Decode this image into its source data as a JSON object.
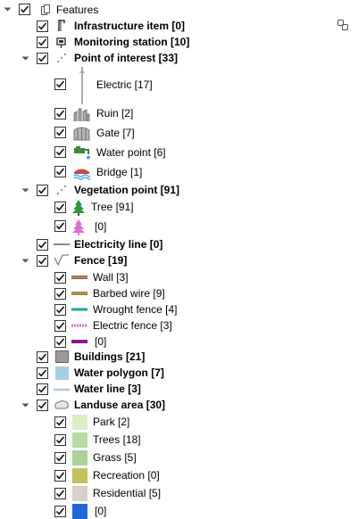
{
  "root": {
    "label": "Features"
  },
  "rows": [
    {
      "label": "Infrastructure item [0]",
      "bold": true
    },
    {
      "label": "Monitoring station [10]",
      "bold": true
    },
    {
      "label": "Point of interest [33]",
      "bold": true
    },
    {
      "label": "Electric [17]",
      "bold": false
    },
    {
      "label": "Ruin [2]",
      "bold": false
    },
    {
      "label": "Gate [7]",
      "bold": false
    },
    {
      "label": "Water point [6]",
      "bold": false
    },
    {
      "label": "Bridge [1]",
      "bold": false
    },
    {
      "label": "Vegetation point [91]",
      "bold": true
    },
    {
      "label": "Tree [91]",
      "bold": false
    },
    {
      "label": "[0]",
      "bold": false
    },
    {
      "label": "Electricity line [0]",
      "bold": true
    },
    {
      "label": "Fence [19]",
      "bold": true
    },
    {
      "label": "Wall [3]",
      "bold": false
    },
    {
      "label": "Barbed wire [9]",
      "bold": false
    },
    {
      "label": "Wrought fence [4]",
      "bold": false
    },
    {
      "label": "Electric fence [3]",
      "bold": false
    },
    {
      "label": "[0]",
      "bold": false
    },
    {
      "label": "Buildings [21]",
      "bold": true
    },
    {
      "label": "Water polygon [7]",
      "bold": true
    },
    {
      "label": "Water line [3]",
      "bold": true
    },
    {
      "label": "Landuse area [30]",
      "bold": true
    },
    {
      "label": "Park [2]",
      "bold": false
    },
    {
      "label": "Trees [18]",
      "bold": false
    },
    {
      "label": "Grass [5]",
      "bold": false
    },
    {
      "label": "Recreation [0]",
      "bold": false
    },
    {
      "label": "Residential [5]",
      "bold": false
    },
    {
      "label": "[0]",
      "bold": false
    }
  ],
  "colors": {
    "wall": "#8b5a3c",
    "barbed_wire": "#9a7b3a",
    "wrought_fence": "#16a99a",
    "electric_fence": "#d86fd1",
    "fence_unknown": "#8a1a8a",
    "buildings": "#9a9a9a",
    "water_polygon": "#a6cee3",
    "water_line": "#a6cee3",
    "electricity_line": "#8a8a8a",
    "park": "#d9efc2",
    "trees": "#b7dca3",
    "grass": "#a9d19a",
    "recreation": "#c1c35e",
    "residential": "#d8cfca",
    "landuse_unknown": "#2266d6",
    "tree_icon": "#2c9a3c",
    "tree_unknown_icon": "#d86fd1"
  },
  "icons": {
    "root": "features-group-icon",
    "infrastructure": "infrastructure-item-icon",
    "monitoring": "monitoring-station-icon",
    "poi": "point-of-interest-icon",
    "electric": "electric-pole-icon",
    "ruin": "ruin-icon",
    "gate": "gate-icon",
    "water_point": "water-point-icon",
    "bridge": "bridge-icon",
    "vegetation": "vegetation-point-icon",
    "tree": "tree-icon",
    "fence": "fence-group-icon",
    "landuse": "landuse-group-icon",
    "panel_button": "link-layers-icon"
  }
}
